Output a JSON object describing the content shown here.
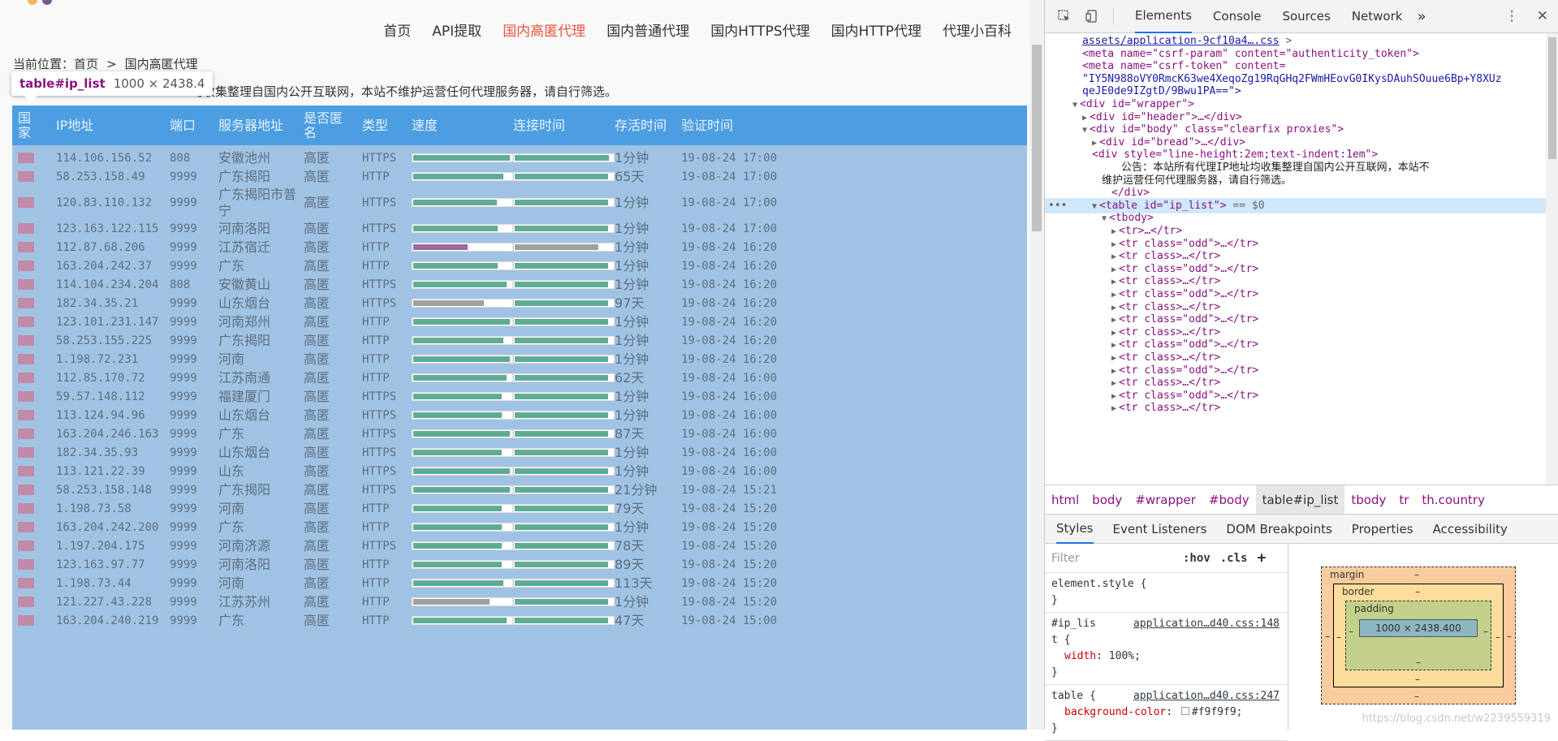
{
  "nav": {
    "items": [
      "首页",
      "API提取",
      "国内高匿代理",
      "国内普通代理",
      "国内HTTPS代理",
      "国内HTTP代理",
      "代理小百科"
    ],
    "active_index": 2
  },
  "breadcrumb": {
    "prefix": "当前位置：",
    "home": "首页",
    "separator": ">",
    "current": "国内高匿代理"
  },
  "notice": "均收集整理自国内公开互联网，本站不维护运营任何代理服务器，请自行筛选。",
  "tooltip": {
    "selector": "table#ip_list",
    "size": "1000 × 2438.4"
  },
  "table": {
    "headers": [
      "国家",
      "IP地址",
      "端口",
      "服务器地址",
      "是否匿名",
      "类型",
      "速度",
      "连接时间",
      "存活时间",
      "验证时间"
    ],
    "rows": [
      {
        "ip": "114.106.156.52",
        "port": "808",
        "addr": "安徽池州",
        "anon": "高匿",
        "type": "HTTPS",
        "speed": 0.98,
        "speed_color": "#5fab96",
        "conn": 0.96,
        "conn_color": "#5fab96",
        "alive": "1分钟",
        "verified": "19-08-24 17:00"
      },
      {
        "ip": "58.253.158.49",
        "port": "9999",
        "addr": "广东揭阳",
        "anon": "高匿",
        "type": "HTTP",
        "speed": 0.92,
        "speed_color": "#5fab96",
        "conn": 0.95,
        "conn_color": "#5fab96",
        "alive": "65天",
        "verified": "19-08-24 17:00"
      },
      {
        "ip": "120.83.110.132",
        "port": "9999",
        "addr": "广东揭阳市普宁",
        "anon": "高匿",
        "type": "HTTPS",
        "speed": 0.85,
        "speed_color": "#5fab96",
        "conn": 0.95,
        "conn_color": "#5fab96",
        "alive": "1分钟",
        "verified": "19-08-24 17:00"
      },
      {
        "ip": "123.163.122.115",
        "port": "9999",
        "addr": "河南洛阳",
        "anon": "高匿",
        "type": "HTTPS",
        "speed": 0.86,
        "speed_color": "#5fab96",
        "conn": 0.95,
        "conn_color": "#5fab96",
        "alive": "1分钟",
        "verified": "19-08-24 17:00"
      },
      {
        "ip": "112.87.68.206",
        "port": "9999",
        "addr": "江苏宿迁",
        "anon": "高匿",
        "type": "HTTP",
        "speed": 0.55,
        "speed_color": "#9b6a9e",
        "conn": 0.85,
        "conn_color": "#a0a0a0",
        "alive": "1分钟",
        "verified": "19-08-24 16:20"
      },
      {
        "ip": "163.204.242.37",
        "port": "9999",
        "addr": "广东",
        "anon": "高匿",
        "type": "HTTP",
        "speed": 0.86,
        "speed_color": "#5fab96",
        "conn": 0.95,
        "conn_color": "#5fab96",
        "alive": "1分钟",
        "verified": "19-08-24 16:20"
      },
      {
        "ip": "114.104.234.204",
        "port": "808",
        "addr": "安徽黄山",
        "anon": "高匿",
        "type": "HTTPS",
        "speed": 0.95,
        "speed_color": "#5fab96",
        "conn": 0.95,
        "conn_color": "#5fab96",
        "alive": "1分钟",
        "verified": "19-08-24 16:20"
      },
      {
        "ip": "182.34.35.21",
        "port": "9999",
        "addr": "山东烟台",
        "anon": "高匿",
        "type": "HTTPS",
        "speed": 0.72,
        "speed_color": "#a0a0a0",
        "conn": 0.95,
        "conn_color": "#5fab96",
        "alive": "97天",
        "verified": "19-08-24 16:20"
      },
      {
        "ip": "123.101.231.147",
        "port": "9999",
        "addr": "河南郑州",
        "anon": "高匿",
        "type": "HTTP",
        "speed": 0.98,
        "speed_color": "#5fab96",
        "conn": 0.95,
        "conn_color": "#5fab96",
        "alive": "1分钟",
        "verified": "19-08-24 16:20"
      },
      {
        "ip": "58.253.155.225",
        "port": "9999",
        "addr": "广东揭阳",
        "anon": "高匿",
        "type": "HTTP",
        "speed": 0.92,
        "speed_color": "#5fab96",
        "conn": 0.95,
        "conn_color": "#5fab96",
        "alive": "1分钟",
        "verified": "19-08-24 16:20"
      },
      {
        "ip": "1.198.72.231",
        "port": "9999",
        "addr": "河南",
        "anon": "高匿",
        "type": "HTTP",
        "speed": 0.98,
        "speed_color": "#5fab96",
        "conn": 0.95,
        "conn_color": "#5fab96",
        "alive": "1分钟",
        "verified": "19-08-24 16:20"
      },
      {
        "ip": "112.85.170.72",
        "port": "9999",
        "addr": "江苏南通",
        "anon": "高匿",
        "type": "HTTP",
        "speed": 0.95,
        "speed_color": "#5fab96",
        "conn": 0.95,
        "conn_color": "#5fab96",
        "alive": "62天",
        "verified": "19-08-24 16:00"
      },
      {
        "ip": "59.57.148.112",
        "port": "9999",
        "addr": "福建厦门",
        "anon": "高匿",
        "type": "HTTPS",
        "speed": 0.9,
        "speed_color": "#5fab96",
        "conn": 0.95,
        "conn_color": "#5fab96",
        "alive": "1分钟",
        "verified": "19-08-24 16:00"
      },
      {
        "ip": "113.124.94.96",
        "port": "9999",
        "addr": "山东烟台",
        "anon": "高匿",
        "type": "HTTPS",
        "speed": 0.9,
        "speed_color": "#5fab96",
        "conn": 0.95,
        "conn_color": "#5fab96",
        "alive": "1分钟",
        "verified": "19-08-24 16:00"
      },
      {
        "ip": "163.204.246.163",
        "port": "9999",
        "addr": "广东",
        "anon": "高匿",
        "type": "HTTPS",
        "speed": 0.98,
        "speed_color": "#5fab96",
        "conn": 0.95,
        "conn_color": "#5fab96",
        "alive": "87天",
        "verified": "19-08-24 16:00"
      },
      {
        "ip": "182.34.35.93",
        "port": "9999",
        "addr": "山东烟台",
        "anon": "高匿",
        "type": "HTTPS",
        "speed": 0.9,
        "speed_color": "#5fab96",
        "conn": 0.95,
        "conn_color": "#5fab96",
        "alive": "1分钟",
        "verified": "19-08-24 16:00"
      },
      {
        "ip": "113.121.22.39",
        "port": "9999",
        "addr": "山东",
        "anon": "高匿",
        "type": "HTTPS",
        "speed": 0.98,
        "speed_color": "#5fab96",
        "conn": 0.95,
        "conn_color": "#5fab96",
        "alive": "1分钟",
        "verified": "19-08-24 16:00"
      },
      {
        "ip": "58.253.158.148",
        "port": "9999",
        "addr": "广东揭阳",
        "anon": "高匿",
        "type": "HTTPS",
        "speed": 0.98,
        "speed_color": "#5fab96",
        "conn": 0.95,
        "conn_color": "#5fab96",
        "alive": "21分钟",
        "verified": "19-08-24 15:21"
      },
      {
        "ip": "1.198.73.58",
        "port": "9999",
        "addr": "河南",
        "anon": "高匿",
        "type": "HTTP",
        "speed": 0.9,
        "speed_color": "#5fab96",
        "conn": 0.95,
        "conn_color": "#5fab96",
        "alive": "79天",
        "verified": "19-08-24 15:20"
      },
      {
        "ip": "163.204.242.200",
        "port": "9999",
        "addr": "广东",
        "anon": "高匿",
        "type": "HTTP",
        "speed": 0.9,
        "speed_color": "#5fab96",
        "conn": 0.95,
        "conn_color": "#5fab96",
        "alive": "1分钟",
        "verified": "19-08-24 15:20"
      },
      {
        "ip": "1.197.204.175",
        "port": "9999",
        "addr": "河南济源",
        "anon": "高匿",
        "type": "HTTPS",
        "speed": 0.9,
        "speed_color": "#5fab96",
        "conn": 0.95,
        "conn_color": "#5fab96",
        "alive": "78天",
        "verified": "19-08-24 15:20"
      },
      {
        "ip": "123.163.97.77",
        "port": "9999",
        "addr": "河南洛阳",
        "anon": "高匿",
        "type": "HTTP",
        "speed": 0.9,
        "speed_color": "#5fab96",
        "conn": 0.95,
        "conn_color": "#5fab96",
        "alive": "89天",
        "verified": "19-08-24 15:20"
      },
      {
        "ip": "1.198.73.44",
        "port": "9999",
        "addr": "河南",
        "anon": "高匿",
        "type": "HTTP",
        "speed": 0.92,
        "speed_color": "#5fab96",
        "conn": 0.95,
        "conn_color": "#5fab96",
        "alive": "113天",
        "verified": "19-08-24 15:20"
      },
      {
        "ip": "121.227.43.228",
        "port": "9999",
        "addr": "江苏苏州",
        "anon": "高匿",
        "type": "HTTP",
        "speed": 0.78,
        "speed_color": "#a0a0a0",
        "conn": 0.95,
        "conn_color": "#5fab96",
        "alive": "1分钟",
        "verified": "19-08-24 15:20"
      },
      {
        "ip": "163.204.240.219",
        "port": "9999",
        "addr": "广东",
        "anon": "高匿",
        "type": "HTTP",
        "speed": 0.95,
        "speed_color": "#5fab96",
        "conn": 0.95,
        "conn_color": "#5fab96",
        "alive": "47天",
        "verified": "19-08-24 15:00"
      }
    ]
  },
  "devtools": {
    "tabs": [
      "Elements",
      "Console",
      "Sources",
      "Network"
    ],
    "active_tab": "Elements",
    "more": "»",
    "elements_tree": [
      {
        "indent": 3,
        "kind": "link",
        "text": "assets/application-9cf10a4….css",
        "suffix": " >"
      },
      {
        "indent": 3,
        "kind": "tag",
        "text": "<meta name=\"csrf-param\" content=\"authenticity_token\">"
      },
      {
        "indent": 3,
        "kind": "tag",
        "text": "<meta name=\"csrf-token\" content="
      },
      {
        "indent": 3,
        "kind": "val",
        "text": "\"IY5N988oVY0RmcK63we4XeqoZg19RqGHq2FWmHEovG0IKysDAuhSOuue6Bp+Y8XUz"
      },
      {
        "indent": 3,
        "kind": "val",
        "text": "qeJE0de9IZgtD/9Bwu1PA==\">"
      },
      {
        "indent": 2,
        "kind": "tag",
        "arrow": "▼",
        "text": "<div id=\"wrapper\">"
      },
      {
        "indent": 3,
        "kind": "tag",
        "arrow": "▶",
        "text": "<div id=\"header\">…</div>"
      },
      {
        "indent": 3,
        "kind": "tag",
        "arrow": "▼",
        "text": "<div id=\"body\" class=\"clearfix proxies\">"
      },
      {
        "indent": 4,
        "kind": "tag",
        "arrow": "▶",
        "text": "<div id=\"bread\">…</div>"
      },
      {
        "indent": 4,
        "kind": "tag",
        "text": "<div style=\"line-height:2em;text-indent:1em\">"
      },
      {
        "indent": 7,
        "kind": "text",
        "text": "公告：本站所有代理IP地址均收集整理自国内公开互联网，本站不"
      },
      {
        "indent": 5,
        "kind": "text",
        "text": "维护运营任何代理服务器，请自行筛选。"
      },
      {
        "indent": 6,
        "kind": "tag",
        "text": "</div>"
      },
      {
        "indent": 4,
        "kind": "tag",
        "arrow": "▼",
        "text": "<table id=\"ip_list\">",
        "suffix": " == $0",
        "selected": true
      },
      {
        "indent": 5,
        "kind": "tag",
        "arrow": "▼",
        "text": "<tbody>"
      },
      {
        "indent": 6,
        "kind": "tag",
        "arrow": "▶",
        "text": "<tr>…</tr>"
      },
      {
        "indent": 6,
        "kind": "tag",
        "arrow": "▶",
        "text": "<tr class=\"odd\">…</tr>"
      },
      {
        "indent": 6,
        "kind": "tag",
        "arrow": "▶",
        "text": "<tr class>…</tr>"
      },
      {
        "indent": 6,
        "kind": "tag",
        "arrow": "▶",
        "text": "<tr class=\"odd\">…</tr>"
      },
      {
        "indent": 6,
        "kind": "tag",
        "arrow": "▶",
        "text": "<tr class>…</tr>"
      },
      {
        "indent": 6,
        "kind": "tag",
        "arrow": "▶",
        "text": "<tr class=\"odd\">…</tr>"
      },
      {
        "indent": 6,
        "kind": "tag",
        "arrow": "▶",
        "text": "<tr class>…</tr>"
      },
      {
        "indent": 6,
        "kind": "tag",
        "arrow": "▶",
        "text": "<tr class=\"odd\">…</tr>"
      },
      {
        "indent": 6,
        "kind": "tag",
        "arrow": "▶",
        "text": "<tr class>…</tr>"
      },
      {
        "indent": 6,
        "kind": "tag",
        "arrow": "▶",
        "text": "<tr class=\"odd\">…</tr>"
      },
      {
        "indent": 6,
        "kind": "tag",
        "arrow": "▶",
        "text": "<tr class>…</tr>"
      },
      {
        "indent": 6,
        "kind": "tag",
        "arrow": "▶",
        "text": "<tr class=\"odd\">…</tr>"
      },
      {
        "indent": 6,
        "kind": "tag",
        "arrow": "▶",
        "text": "<tr class>…</tr>"
      },
      {
        "indent": 6,
        "kind": "tag",
        "arrow": "▶",
        "text": "<tr class=\"odd\">…</tr>"
      },
      {
        "indent": 6,
        "kind": "tag",
        "arrow": "▶",
        "text": "<tr class>…</tr>"
      }
    ],
    "selected_marker": "•••",
    "breadcrumbs": [
      "html",
      "body",
      "#wrapper",
      "#body",
      "table#ip_list",
      "tbody",
      "tr",
      "th.country"
    ],
    "breadcrumb_selected": "table#ip_list",
    "subtabs": [
      "Styles",
      "Event Listeners",
      "DOM Breakpoints",
      "Properties",
      "Accessibility"
    ],
    "active_subtab": "Styles",
    "filter_placeholder": "Filter",
    "hov": ":hov",
    "cls": ".cls",
    "add": "+",
    "rules": [
      {
        "selector": "element.style {",
        "source": "",
        "props": [],
        "close": "}"
      },
      {
        "selector": "#ip_lis",
        "selector2": "t {",
        "source": "application…d40.css:148",
        "props": [
          {
            "name": "width",
            "value": "100%;"
          }
        ],
        "close": "}"
      },
      {
        "selector": "table {",
        "source": "application…d40.css:247",
        "props": [
          {
            "name": "background-color",
            "value": "#f9f9f9;"
          }
        ],
        "close": "}"
      }
    ],
    "box_model": {
      "margin_label": "margin",
      "border_label": "border",
      "padding_label": "padding",
      "content": "1000 × 2438.400",
      "dash": "–"
    },
    "watermark": "https://blog.csdn.net/w2239559319"
  }
}
